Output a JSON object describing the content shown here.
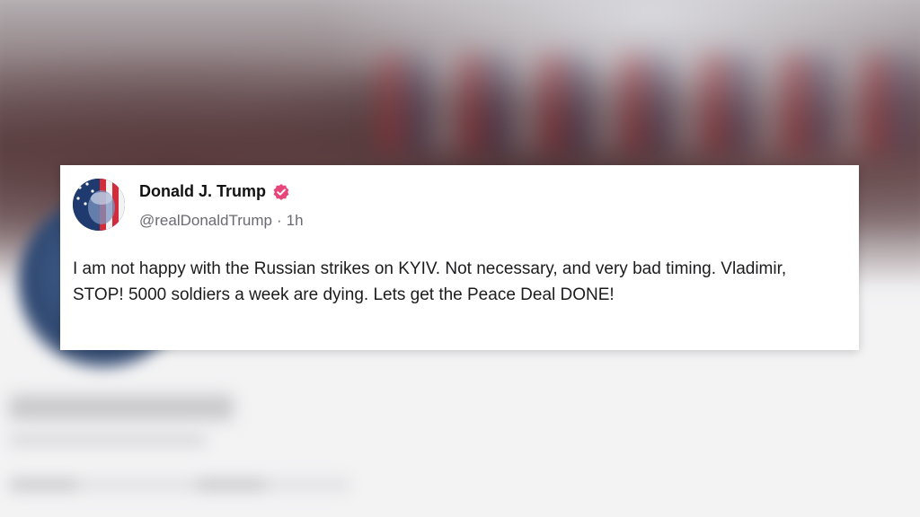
{
  "post": {
    "author_name": "Donald J. Trump",
    "handle": "@realDonaldTrump",
    "separator": "·",
    "time": "1h",
    "text": "I am not happy with the Russian strikes on KYIV. Not necessary, and very bad timing. Vladimir, STOP! 5000 soldiers a week are dying. Lets get the Peace Deal DONE!"
  },
  "icons": {
    "verified": "verified-badge-icon",
    "avatar": "profile-avatar"
  },
  "colors": {
    "verified_badge": "#e8457a",
    "card_background": "#ffffff",
    "text_primary": "#121212",
    "text_secondary": "#6a6a72"
  }
}
